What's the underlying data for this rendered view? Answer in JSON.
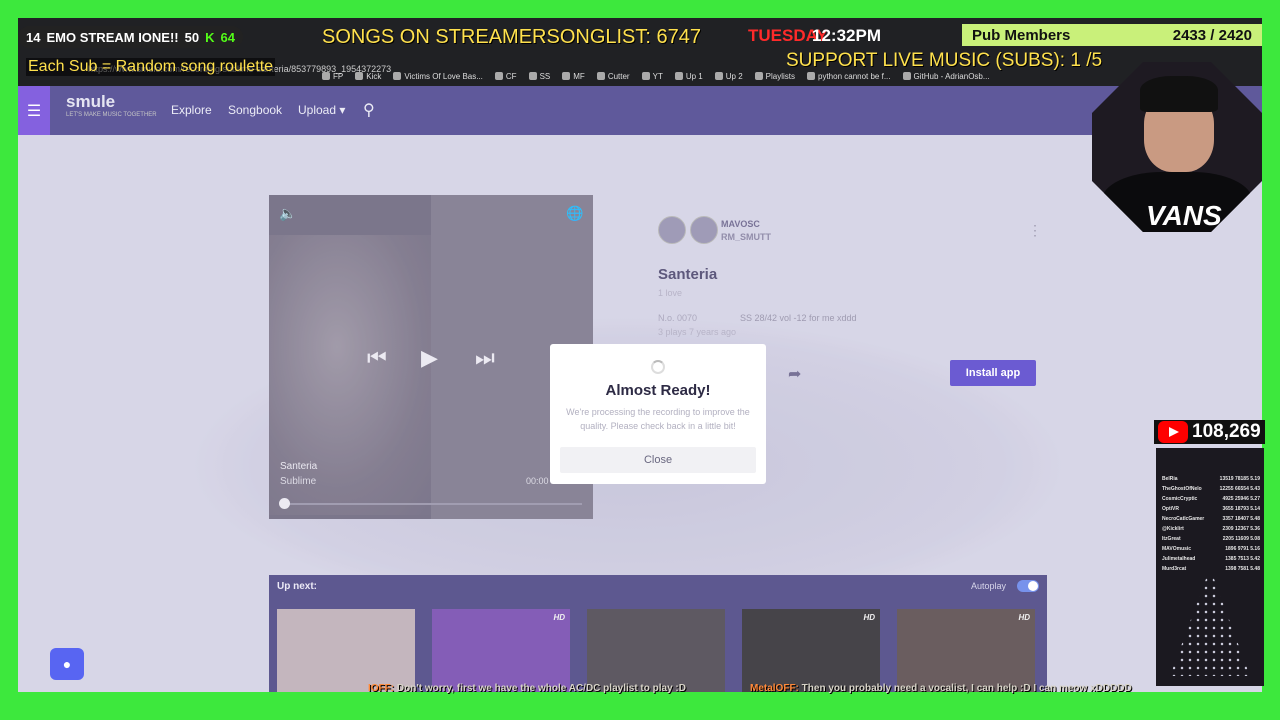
{
  "overlay": {
    "counter_left": "14",
    "stream_title": "EMO STREAM IONE!!",
    "counter_right": "50",
    "kick_count": "64",
    "sub_roulette": "Each Sub = Random song roulette",
    "songs_list": "SONGS ON STREAMERSONGLIST: 6747",
    "day": "TUESDAY",
    "time": "12:32PM",
    "pub_label": "Pub Members",
    "pub_count": "2433 / 2420",
    "support_label": "SUPPORT LIVE MUSIC (SUBS): 1   /5",
    "vans": "VANS",
    "youtube_count": "108,269",
    "discord_icon": "discord-icon",
    "chat": [
      {
        "user": "IOFF:",
        "text": "Don't worry, first we have the whole AC/DC playlist to play :D"
      },
      {
        "user": "MetalOFF:",
        "text": "Then you probably need a vocalist, I can help :D I can meow xDDDDD"
      }
    ]
  },
  "browser": {
    "url": "https://www.smule.com/recording/sublime-santeria/853779893_1954372273",
    "bookmarks": [
      "FP",
      "Kick",
      "Victims Of Love Bas...",
      "CF",
      "SS",
      "MF",
      "Cutter",
      "YT",
      "Up 1",
      "Up 2",
      "Playlists",
      "python cannot be f...",
      "GitHub - AdrianOsb..."
    ]
  },
  "nav": {
    "logo": "smule",
    "logo_tagline": "LET'S MAKE MUSIC TOGETHER",
    "links": [
      "Explore",
      "Songbook",
      "Upload ▾"
    ],
    "menu_icon": "menu-icon",
    "search_icon": "search-icon"
  },
  "player": {
    "song": "Santeria",
    "artist": "Sublime",
    "time": "00:00",
    "progress": 0
  },
  "recording": {
    "user1": "MAVOSC",
    "user2": "RM_SMUTT",
    "title": "Santeria",
    "loves": "1 love",
    "meta_left": "N.o. 0070",
    "meta_right": "SS 28/42 vol -12 for me xddd",
    "plays": "3 plays    7 years ago",
    "install_label": "Install app"
  },
  "upnext": {
    "label": "Up next:",
    "autoplay_label": "Autoplay",
    "autoplay_on": true,
    "thumbs": [
      {
        "hd": "",
        "color": "#b8a6b0"
      },
      {
        "hd": "HD",
        "color": "#6a3aa8"
      },
      {
        "hd": "",
        "color": "#3b3540"
      },
      {
        "hd": "HD",
        "color": "#1e1c22"
      },
      {
        "hd": "HD",
        "color": "#4a3a3c"
      }
    ]
  },
  "modal": {
    "title": "Almost Ready!",
    "text": "We're processing the recording to improve the quality. Please check back in a little bit!",
    "close_label": "Close"
  },
  "leaderboard": [
    [
      "BelRia",
      "13519 78185 5.19"
    ],
    [
      "TheGhostOfNelo",
      "12255 66554 5.43"
    ],
    [
      "CosmicCryptic",
      "4925 25946 5.27"
    ],
    [
      "OptiVR",
      "3655 18793 5.14"
    ],
    [
      "NecroCatlcGamer",
      "3357 18407 5.48"
    ],
    [
      "@Kicklirt",
      "2309 12367 5.36"
    ],
    [
      "ItzGreat",
      "2205 11609 5.08"
    ],
    [
      "MAVOmusic",
      "1896 9791 5.16"
    ],
    [
      "Julimetalhead",
      "1385 7513 5.42"
    ],
    [
      "Murd3rcat",
      "1398 7581 5.48"
    ]
  ],
  "colors": {
    "frame": "#3de83d",
    "nav": "#3c3585",
    "accent": "#4b38c8"
  }
}
